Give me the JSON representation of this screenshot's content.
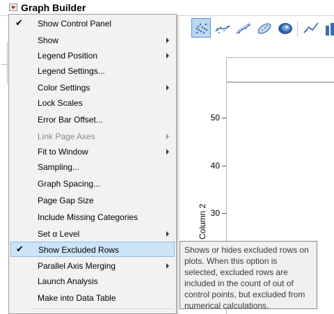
{
  "window": {
    "title": "Graph Builder"
  },
  "menu": {
    "items": [
      {
        "label": "Show Control Panel",
        "checked": true,
        "submenu": false,
        "disabled": false
      },
      {
        "label": "Show",
        "checked": false,
        "submenu": true,
        "disabled": false
      },
      {
        "label": "Legend Position",
        "checked": false,
        "submenu": true,
        "disabled": false
      },
      {
        "label": "Legend Settings...",
        "checked": false,
        "submenu": false,
        "disabled": false
      },
      {
        "label": "Color Settings",
        "checked": false,
        "submenu": true,
        "disabled": false
      },
      {
        "label": "Lock Scales",
        "checked": false,
        "submenu": false,
        "disabled": false
      },
      {
        "label": "Error Bar Offset...",
        "checked": false,
        "submenu": false,
        "disabled": false
      },
      {
        "label": "Link Page Axes",
        "checked": false,
        "submenu": true,
        "disabled": true
      },
      {
        "label": "Fit to Window",
        "checked": false,
        "submenu": true,
        "disabled": false
      },
      {
        "label": "Sampling...",
        "checked": false,
        "submenu": false,
        "disabled": false
      },
      {
        "label": "Graph Spacing...",
        "checked": false,
        "submenu": false,
        "disabled": false
      },
      {
        "label": "Page Gap Size",
        "checked": false,
        "submenu": false,
        "disabled": false
      },
      {
        "label": "Include Missing Categories",
        "checked": false,
        "submenu": false,
        "disabled": false
      },
      {
        "label": "Set α Level",
        "checked": false,
        "submenu": true,
        "disabled": false
      },
      {
        "label": "Show Excluded Rows",
        "checked": true,
        "submenu": false,
        "disabled": false,
        "highlighted": true
      },
      {
        "label": "Parallel Axis Merging",
        "checked": false,
        "submenu": true,
        "disabled": false
      },
      {
        "label": "Launch Analysis",
        "checked": false,
        "submenu": false,
        "disabled": false
      },
      {
        "label": "Make into Data Table",
        "checked": false,
        "submenu": false,
        "disabled": false
      }
    ]
  },
  "tooltip": {
    "text": "Shows or hides excluded rows on plots. When this option is selected, excluded rows are included in the count of out of control points, but excluded from numerical calculations."
  },
  "toolbar": {
    "buttons": [
      "points-icon",
      "smoother-icon",
      "line-of-fit-icon",
      "ellipse-icon",
      "contour-icon",
      "line-icon",
      "bar-icon"
    ],
    "active": "points-icon"
  },
  "graph": {
    "y_axis_title": "Column 2",
    "y_ticks": [
      "50",
      "40",
      "30"
    ]
  },
  "colors": {
    "highlight": "#cce4f7",
    "toolbar_active": "#bcd8f2",
    "title_arrow": "#cc0000"
  }
}
